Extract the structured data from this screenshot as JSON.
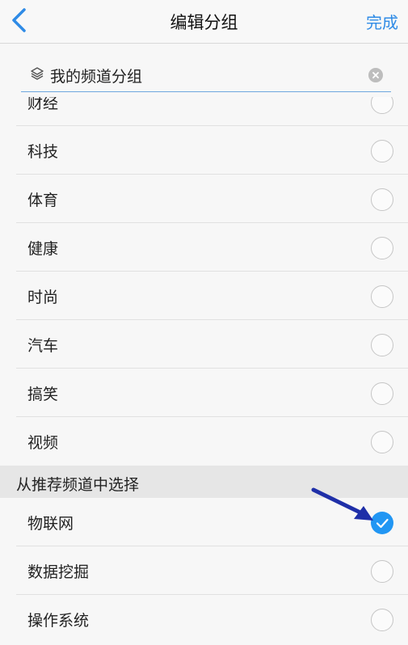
{
  "nav": {
    "title": "编辑分组",
    "done_label": "完成"
  },
  "search": {
    "value": "我的频道分组"
  },
  "channels": [
    {
      "label": "财经",
      "checked": false
    },
    {
      "label": "科技",
      "checked": false
    },
    {
      "label": "体育",
      "checked": false
    },
    {
      "label": "健康",
      "checked": false
    },
    {
      "label": "时尚",
      "checked": false
    },
    {
      "label": "汽车",
      "checked": false
    },
    {
      "label": "搞笑",
      "checked": false
    },
    {
      "label": "视频",
      "checked": false
    }
  ],
  "recommended": {
    "header": "从推荐频道中选择",
    "items": [
      {
        "label": "物联网",
        "checked": true
      },
      {
        "label": "数据挖掘",
        "checked": false
      },
      {
        "label": "操作系统",
        "checked": false
      }
    ]
  },
  "colors": {
    "accent": "#2f8be6",
    "check": "#2196f3",
    "annotation_arrow": "#1f2fa8"
  }
}
